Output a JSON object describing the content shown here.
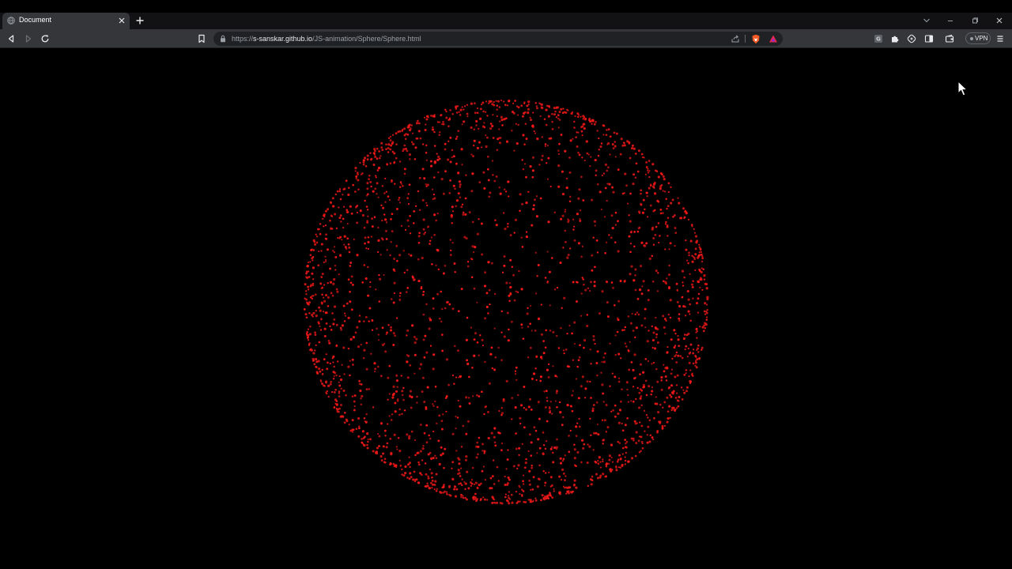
{
  "browser": {
    "tab": {
      "title": "Document"
    },
    "url": {
      "scheme": "https://",
      "host": "s-sanskar.github.io",
      "path": "/JS-animation/Sphere/Sphere.html"
    },
    "vpn_label": "VPN"
  },
  "page": {
    "background": "#000000",
    "particle_color": "#ff1a1a",
    "particle_count": 2600
  },
  "icons": [
    "globe-icon",
    "close-icon",
    "plus-icon",
    "chevron-down-icon",
    "minimize-icon",
    "maximize-icon",
    "back-icon",
    "forward-icon",
    "reload-icon",
    "bookmark-icon",
    "lock-icon",
    "share-icon",
    "brave-shield-icon",
    "rewards-icon",
    "extension-g-icon",
    "puzzle-icon",
    "leo-icon",
    "sidebar-icon",
    "wallet-icon",
    "menu-icon",
    "cursor-icon"
  ]
}
